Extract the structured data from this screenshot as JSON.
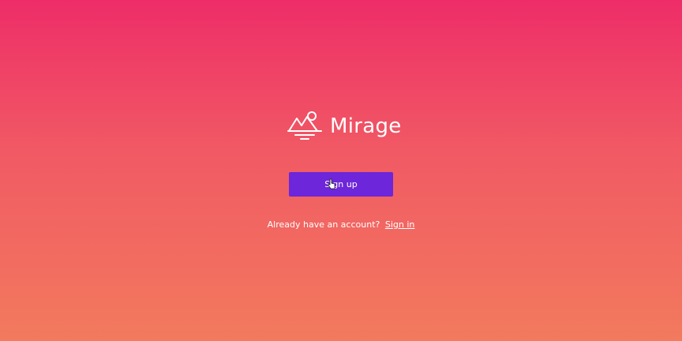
{
  "brand": {
    "name": "Mirage",
    "logo_icon": "mountain-sun-icon"
  },
  "signup": {
    "label": "Sign up"
  },
  "signin": {
    "prompt": "Already have an account?",
    "link_label": "Sign in"
  },
  "colors": {
    "gradient_top": "#ee2d68",
    "gradient_bottom": "#f27a5d",
    "button": "#6d26d9",
    "text": "#ffffff"
  },
  "cursor_icon": "hand-pointer-icon"
}
